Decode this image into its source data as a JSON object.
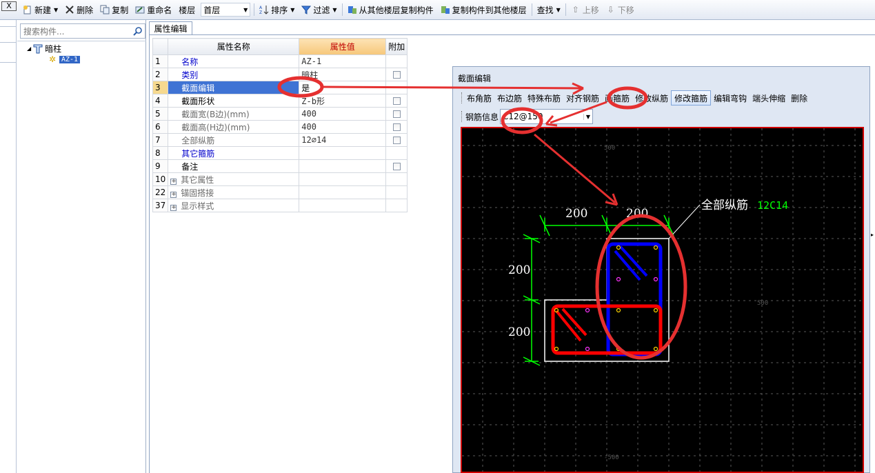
{
  "toolbar": {
    "close": "X",
    "new": "新建",
    "delete": "删除",
    "copy": "复制",
    "rename": "重命名",
    "floor_label": "楼层",
    "floor_value": "首层",
    "sort": "排序",
    "filter": "过滤",
    "copy_from_other_floor": "从其他楼层复制构件",
    "copy_to_other_floor": "复制构件到其他楼层",
    "find": "查找",
    "move_up": "上移",
    "move_down": "下移"
  },
  "tree": {
    "search_placeholder": "搜索构件...",
    "root_label": "暗柱",
    "child_label": "AZ-1"
  },
  "properties": {
    "tab_label": "属性编辑",
    "headers": {
      "name": "属性名称",
      "value": "属性值",
      "extra": "附加"
    },
    "rows": [
      {
        "num": "1",
        "name": "名称",
        "value": "AZ-1",
        "style": "blue",
        "check": false
      },
      {
        "num": "2",
        "name": "类别",
        "value": "暗柱",
        "style": "blue",
        "check": true
      },
      {
        "num": "3",
        "name": "截面编辑",
        "value": "是",
        "style": "sel",
        "check": false
      },
      {
        "num": "4",
        "name": "截面形状",
        "value": "Z-b形",
        "style": "black",
        "check": true
      },
      {
        "num": "5",
        "name": "截面宽(B边)(mm)",
        "value": "400",
        "style": "gray",
        "check": true
      },
      {
        "num": "6",
        "name": "截面高(H边)(mm)",
        "value": "400",
        "style": "gray",
        "check": true
      },
      {
        "num": "7",
        "name": "全部纵筋",
        "value": "12⌀14",
        "style": "gray",
        "check": true
      },
      {
        "num": "8",
        "name": "其它箍筋",
        "value": "",
        "style": "blue",
        "check": false
      },
      {
        "num": "9",
        "name": "备注",
        "value": "",
        "style": "black",
        "check": true
      },
      {
        "num": "10",
        "name": "其它属性",
        "value": "",
        "style": "group",
        "check": false
      },
      {
        "num": "22",
        "name": "锚固搭接",
        "value": "",
        "style": "group",
        "check": false
      },
      {
        "num": "37",
        "name": "显示样式",
        "value": "",
        "style": "group",
        "check": false
      }
    ]
  },
  "dialog": {
    "title": "截面编辑",
    "tools": [
      "布角筋",
      "布边筋",
      "特殊布筋",
      "对齐钢筋",
      "画箍筋",
      "修改纵筋",
      "修改箍筋",
      "编辑弯钩",
      "端头伸缩",
      "删除"
    ],
    "active_tool_index": 6,
    "rebar_label": "钢筋信息",
    "rebar_value": "C12@150"
  },
  "canvas": {
    "grid_labels": {
      "top": "500",
      "right": "500",
      "bottom": "-500"
    },
    "dims": {
      "top_left": "200",
      "top_right": "200",
      "left_top": "200",
      "left_bottom": "200"
    },
    "annotation_label": "全部纵筋",
    "annotation_value": "12C14",
    "colors": {
      "dim": "#00ff00",
      "outline": "#ffffff",
      "stirrup_blue": "#0000ff",
      "stirrup_red": "#ff0000",
      "annot_value": "#00ff00"
    }
  }
}
